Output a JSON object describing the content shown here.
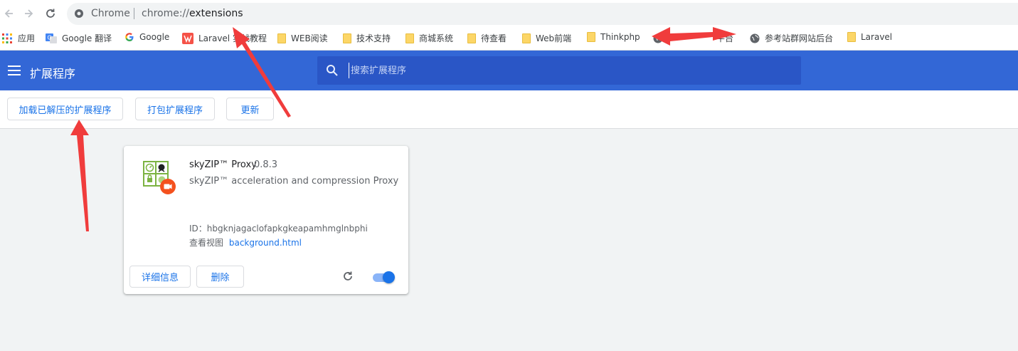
{
  "browser": {
    "omnibox": {
      "chip": "Chrome",
      "url_scheme": "chrome://",
      "url_path": "extensions"
    }
  },
  "bookmarks": [
    {
      "label": "应用",
      "icon": "apps-grid-icon"
    },
    {
      "label": "Google 翻译",
      "icon": "google-translate-icon"
    },
    {
      "label": "Google",
      "icon": "google-icon"
    },
    {
      "label": "Laravel 实战教程",
      "icon": "laravel-icon"
    },
    {
      "label": "WEB阅读",
      "icon": "folder-icon"
    },
    {
      "label": "技术支持",
      "icon": "folder-icon"
    },
    {
      "label": "商城系统",
      "icon": "folder-icon"
    },
    {
      "label": "待查看",
      "icon": "folder-icon"
    },
    {
      "label": "Web前端",
      "icon": "folder-icon"
    },
    {
      "label": "Thinkphp",
      "icon": "folder-icon"
    },
    {
      "label": "平台",
      "icon": "globe-icon"
    },
    {
      "label": "参考站群网站后台",
      "icon": "globe-icon"
    },
    {
      "label": "Laravel",
      "icon": "folder-icon"
    }
  ],
  "header": {
    "title": "扩展程序",
    "search_placeholder": "搜索扩展程序"
  },
  "devbar": {
    "load_unpacked": "加载已解压的扩展程序",
    "pack": "打包扩展程序",
    "update": "更新"
  },
  "extension": {
    "name": "skyZIP™ Proxy",
    "version": "0.8.3",
    "description": "skyZIP™ acceleration and compression Proxy",
    "id_line": "ID：hbgknjagaclofapkgkeapamhmglnbphi",
    "views_label": "查看视图",
    "views_link": "background.html",
    "details_button": "详细信息",
    "remove_button": "删除",
    "enabled": true
  },
  "colors": {
    "header": "#3367d6",
    "accent": "#1a73e8",
    "arrow": "#f03c3c"
  }
}
